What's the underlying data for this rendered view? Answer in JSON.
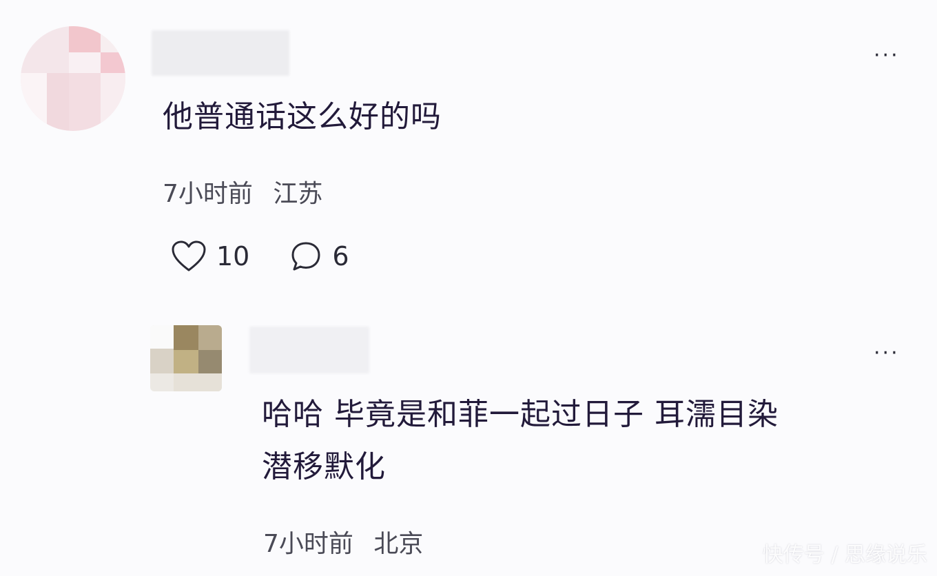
{
  "comments": [
    {
      "text": "他普通话这么好的吗",
      "time": "7小时前",
      "location": "江苏",
      "likes": "10",
      "replies": "6",
      "more_label": "···"
    },
    {
      "text_line1": "哈哈  毕竟是和菲一起过日子  耳濡目染",
      "text_line2": "潜移默化",
      "time": "7小时前",
      "location": "北京",
      "more_label": "···"
    }
  ],
  "icons": {
    "like": "heart-icon",
    "reply": "comment-bubble-icon",
    "more": "more-dots-icon"
  },
  "colors": {
    "background": "#fbfbfd",
    "text": "#221a3a",
    "meta": "#4a4a56"
  },
  "watermark": "快传号 / 思缘说乐"
}
